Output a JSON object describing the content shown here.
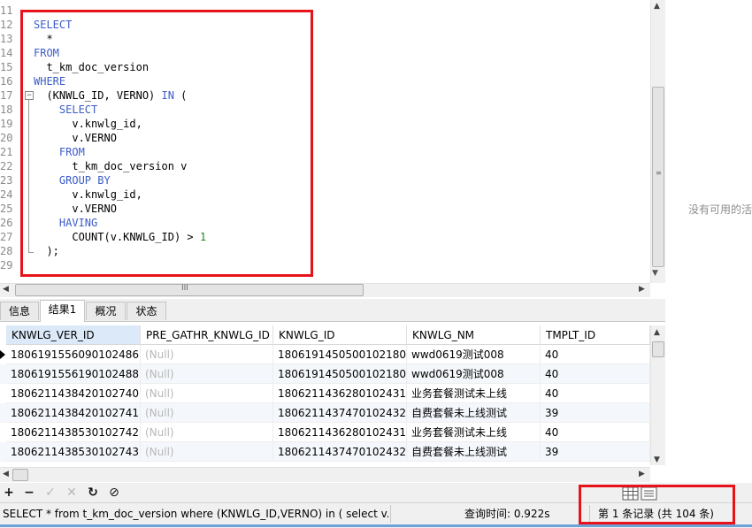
{
  "editor": {
    "line_numbers": [
      "11",
      "12",
      "13",
      "14",
      "15",
      "16",
      "17",
      "18",
      "19",
      "20",
      "21",
      "22",
      "23",
      "24",
      "25",
      "26",
      "27",
      "28",
      "29"
    ],
    "lines": [
      {
        "parts": [
          {
            "t": "",
            "c": ""
          }
        ]
      },
      {
        "parts": [
          {
            "t": "SELECT",
            "c": "kw"
          }
        ]
      },
      {
        "parts": [
          {
            "t": "  *",
            "c": ""
          }
        ]
      },
      {
        "parts": [
          {
            "t": "FROM",
            "c": "kw"
          }
        ]
      },
      {
        "parts": [
          {
            "t": "  t_km_doc_version",
            "c": ""
          }
        ]
      },
      {
        "parts": [
          {
            "t": "WHERE",
            "c": "kw"
          }
        ]
      },
      {
        "parts": [
          {
            "t": "  (KNWLG_ID, VERNO) ",
            "c": ""
          },
          {
            "t": "IN",
            "c": "kw"
          },
          {
            "t": " (",
            "c": ""
          }
        ]
      },
      {
        "parts": [
          {
            "t": "    ",
            "c": ""
          },
          {
            "t": "SELECT",
            "c": "kw"
          }
        ]
      },
      {
        "parts": [
          {
            "t": "      v.knwlg_id,",
            "c": ""
          }
        ]
      },
      {
        "parts": [
          {
            "t": "      v.VERNO",
            "c": ""
          }
        ]
      },
      {
        "parts": [
          {
            "t": "    ",
            "c": ""
          },
          {
            "t": "FROM",
            "c": "kw"
          }
        ]
      },
      {
        "parts": [
          {
            "t": "      t_km_doc_version v",
            "c": ""
          }
        ]
      },
      {
        "parts": [
          {
            "t": "    ",
            "c": ""
          },
          {
            "t": "GROUP BY",
            "c": "kw"
          }
        ]
      },
      {
        "parts": [
          {
            "t": "      v.knwlg_id,",
            "c": ""
          }
        ]
      },
      {
        "parts": [
          {
            "t": "      v.VERNO",
            "c": ""
          }
        ]
      },
      {
        "parts": [
          {
            "t": "    ",
            "c": ""
          },
          {
            "t": "HAVING",
            "c": "kw"
          }
        ]
      },
      {
        "parts": [
          {
            "t": "      COUNT(v.KNWLG_ID) > ",
            "c": ""
          },
          {
            "t": "1",
            "c": "num"
          }
        ]
      },
      {
        "parts": [
          {
            "t": "  );",
            "c": ""
          }
        ]
      },
      {
        "parts": [
          {
            "t": "",
            "c": ""
          }
        ]
      }
    ],
    "fold_toggle": "−",
    "hscroll_grip": "III"
  },
  "right_panel": {
    "hint": "没有可用的活"
  },
  "tabs": [
    {
      "label": "信息",
      "active": false
    },
    {
      "label": "结果1",
      "active": true
    },
    {
      "label": "概况",
      "active": false
    },
    {
      "label": "状态",
      "active": false
    }
  ],
  "grid": {
    "columns": [
      "KNWLG_VER_ID",
      "PRE_GATHR_KNWLG_ID",
      "KNWLG_ID",
      "KNWLG_NM",
      "TMPLT_ID"
    ],
    "rows": [
      [
        "1806191556090102486",
        "(Null)",
        "1806191450500102180",
        "wwd0619测试008",
        "40"
      ],
      [
        "1806191556190102488",
        "(Null)",
        "1806191450500102180",
        "wwd0619测试008",
        "40"
      ],
      [
        "1806211438420102740",
        "(Null)",
        "1806211436280102431",
        "业务套餐测试未上线",
        "40"
      ],
      [
        "1806211438420102741",
        "(Null)",
        "1806211437470102432",
        "自费套餐未上线测试",
        "39"
      ],
      [
        "1806211438530102742",
        "(Null)",
        "1806211436280102431",
        "业务套餐测试未上线",
        "40"
      ],
      [
        "1806211438530102743",
        "(Null)",
        "1806211437470102432",
        "自费套餐未上线测试",
        "39"
      ]
    ]
  },
  "toolbar": {
    "add": "+",
    "delete": "−",
    "apply": "✓",
    "cancel": "✕",
    "refresh": "↻",
    "stop": "⊘"
  },
  "status": {
    "sql": "SELECT * from t_km_doc_version where (KNWLG_ID,VERNO) in ( select v.kn",
    "query_time": "查询时间: 0.922s",
    "records": "第 1 条记录 (共 104 条)"
  },
  "colors": {
    "keyword": "#3c5cc8",
    "number": "#1a8a1a",
    "annotation": "#e8121b",
    "selected_header": "#dce9f8"
  }
}
